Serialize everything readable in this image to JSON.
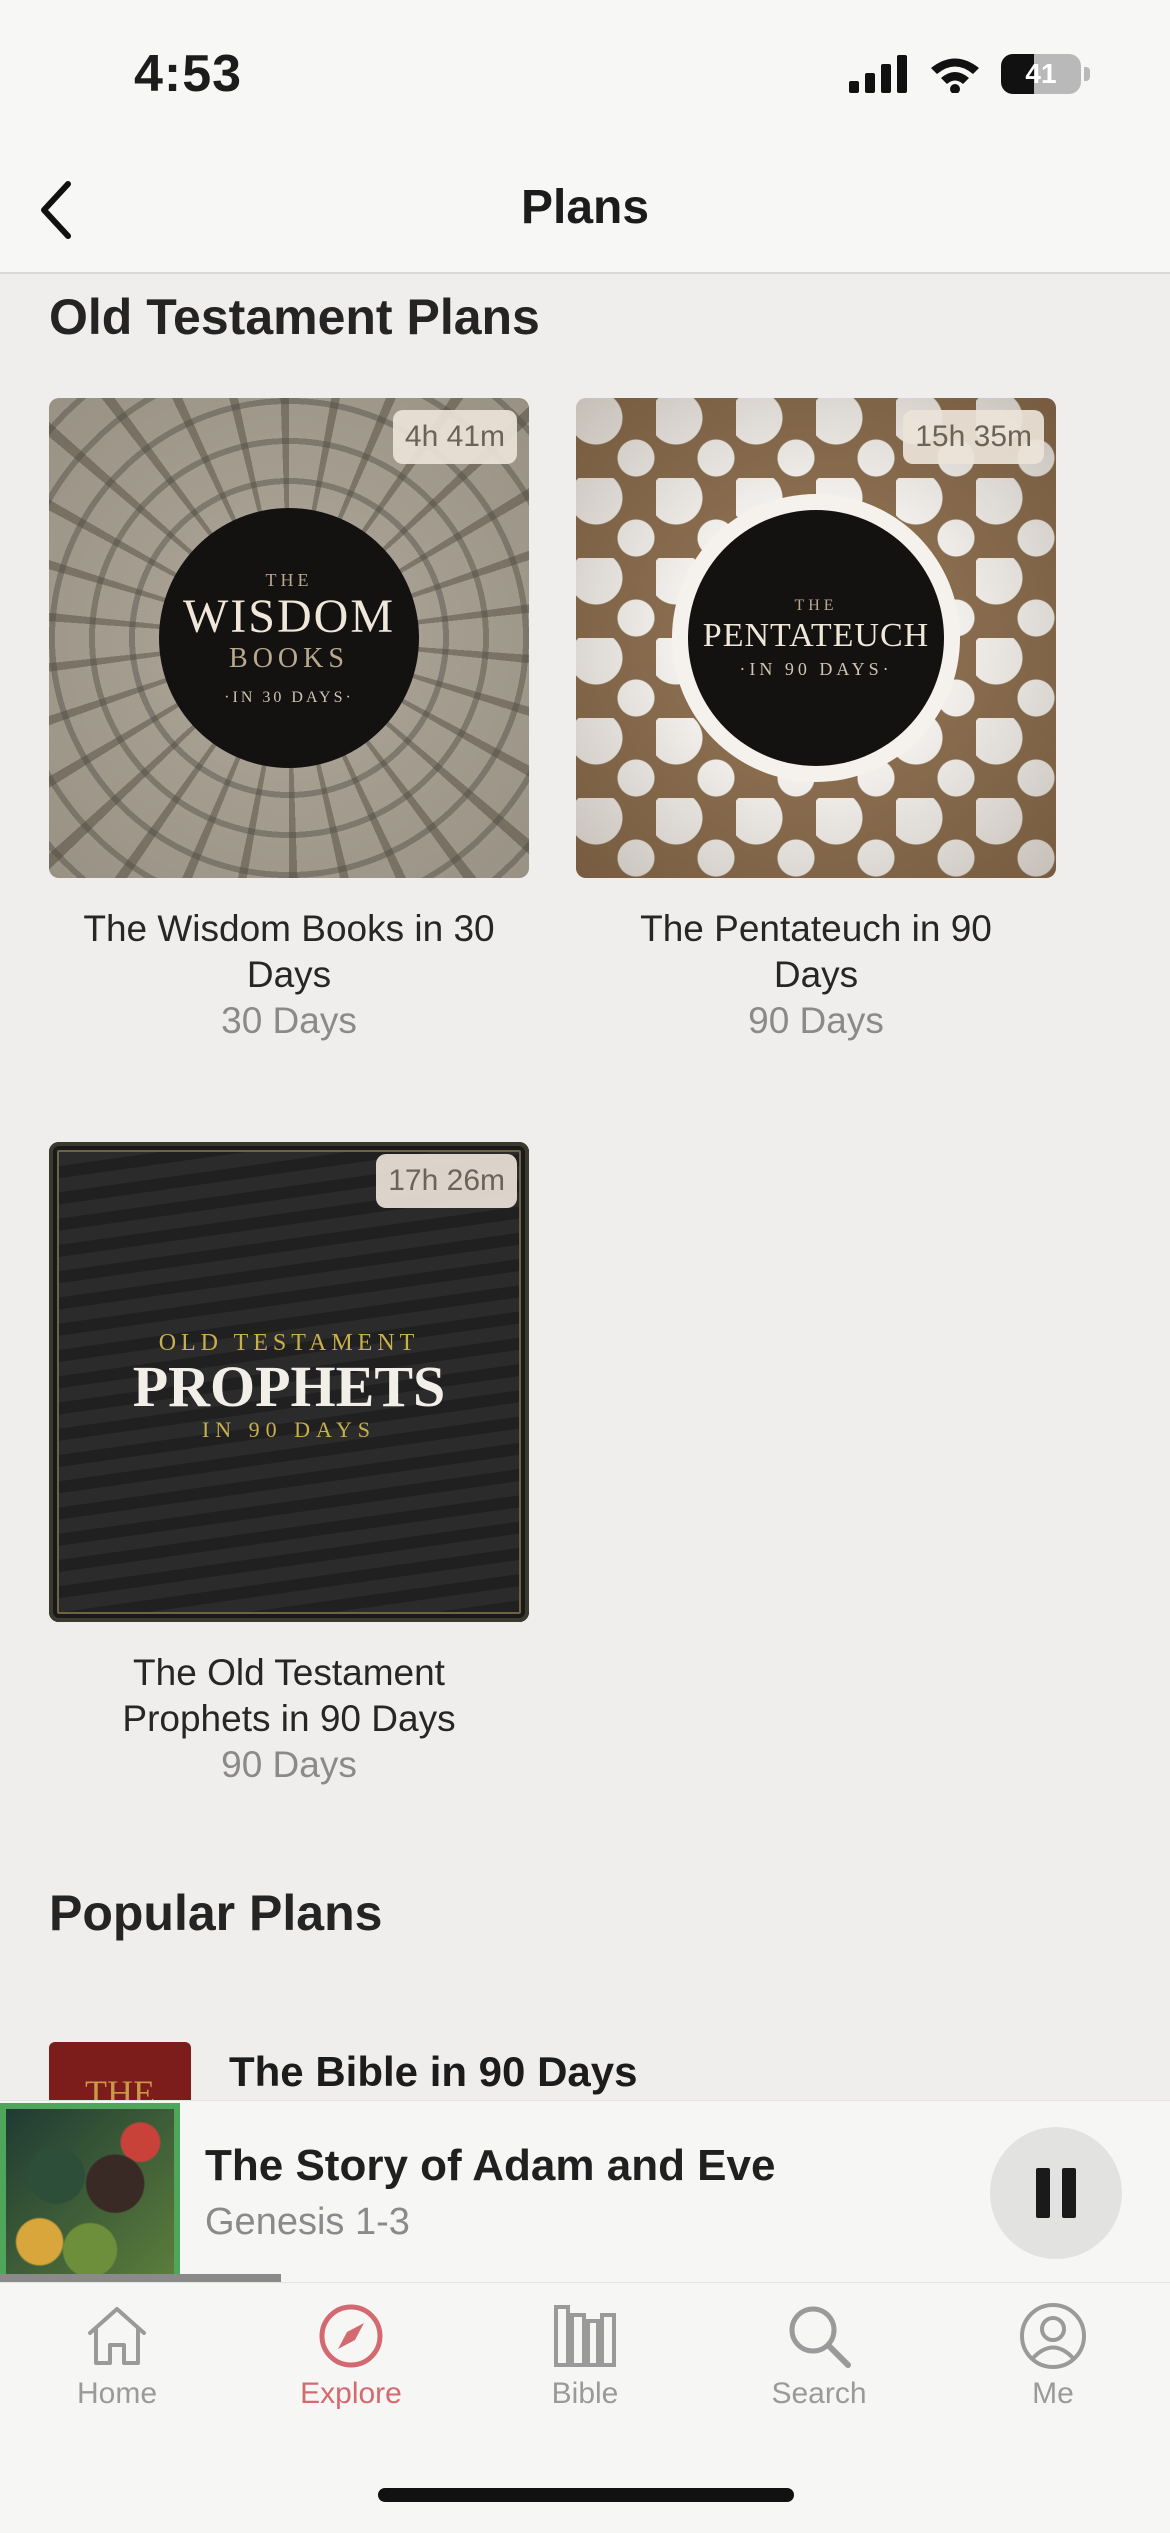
{
  "status_bar": {
    "time": "4:53",
    "battery": "41"
  },
  "nav": {
    "title": "Plans"
  },
  "sections": {
    "old_testament": {
      "title": "Old Testament Plans",
      "plans": [
        {
          "badge": "4h 41m",
          "title": "The Wisdom Books in 30 Days",
          "subtitle": "30 Days",
          "cover": {
            "top": "THE",
            "main": "WISDOM",
            "second": "BOOKS",
            "bottom": "·IN 30 DAYS·"
          }
        },
        {
          "badge": "15h 35m",
          "title": "The Pentateuch in 90 Days",
          "subtitle": "90 Days",
          "cover": {
            "top": "THE",
            "main": "PENTATEUCH",
            "bottom": "·IN 90 DAYS·"
          }
        },
        {
          "badge": "17h 26m",
          "title": "The Old Testament Prophets in 90 Days",
          "subtitle": "90 Days",
          "cover": {
            "top": "OLD TESTAMENT",
            "main": "PROPHETS",
            "bottom": "IN 90 DAYS"
          }
        }
      ]
    },
    "popular": {
      "title": "Popular Plans",
      "first_item": {
        "title": "The Bible in 90 Days",
        "thumb_text": "THE"
      }
    }
  },
  "now_playing": {
    "title": "The Story of Adam and Eve",
    "subtitle": "Genesis 1-3",
    "progress": 0.24
  },
  "tabs": [
    {
      "label": "Home",
      "icon": "house-icon"
    },
    {
      "label": "Explore",
      "icon": "compass-icon",
      "active": true
    },
    {
      "label": "Bible",
      "icon": "books-icon"
    },
    {
      "label": "Search",
      "icon": "magnifier-icon"
    },
    {
      "label": "Me",
      "icon": "person-circle-icon"
    }
  ],
  "colors": {
    "accent": "#d36a72",
    "now_playing_border": "#4fa65b"
  }
}
